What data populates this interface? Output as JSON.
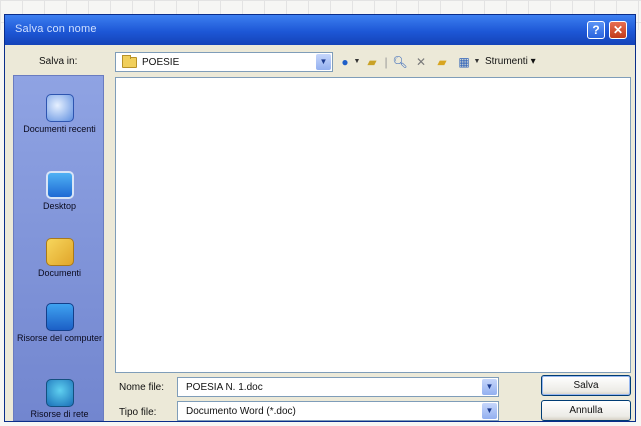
{
  "window": {
    "title": "Salva con nome"
  },
  "titlebar": {
    "help_glyph": "?",
    "close_glyph": "✕"
  },
  "location": {
    "label": "Salva in:",
    "value": "POESIE",
    "icon": "folder-icon"
  },
  "toolbar": {
    "tools_label": "Strumenti",
    "items": [
      "back-icon",
      "up-folder-icon",
      "search-web-icon",
      "delete-icon",
      "new-folder-icon",
      "views-icon",
      "tools-menu"
    ]
  },
  "places": [
    {
      "label": "Documenti recenti",
      "icon": "recent-documents-icon"
    },
    {
      "label": "Desktop",
      "icon": "desktop-icon"
    },
    {
      "label": "Documenti",
      "icon": "my-documents-icon"
    },
    {
      "label": "Risorse del computer",
      "icon": "my-computer-icon"
    },
    {
      "label": "Risorse di rete",
      "icon": "network-places-icon"
    }
  ],
  "filename": {
    "label": "Nome file:",
    "value": "POESIA N. 1.doc"
  },
  "filetype": {
    "label": "Tipo file:",
    "value": "Documento Word (*.doc)"
  },
  "buttons": {
    "save": "Salva",
    "cancel": "Annulla"
  },
  "colors": {
    "titlebar": "#1d57d6",
    "dialog_bg": "#ece9d8",
    "places_bar": "#7b8fd6"
  }
}
